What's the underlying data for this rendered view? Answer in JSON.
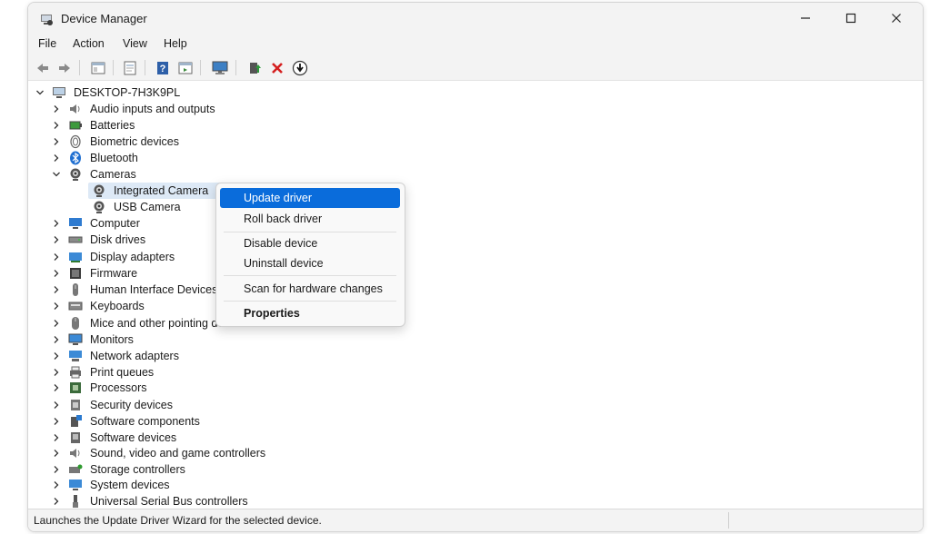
{
  "window": {
    "title": "Device Manager",
    "controls": [
      "—",
      "☐",
      "✕"
    ]
  },
  "menu": [
    "File",
    "Action",
    "View",
    "Help"
  ],
  "toolbar": [
    {
      "name": "back-arrow-icon"
    },
    {
      "name": "forward-arrow-icon"
    },
    {
      "name": "show-hide-tree-icon"
    },
    {
      "name": "properties-icon"
    },
    {
      "name": "help-icon"
    },
    {
      "name": "view-icon"
    },
    {
      "name": "monitor-icon"
    },
    {
      "name": "update-driver-icon"
    },
    {
      "name": "uninstall-x-icon"
    },
    {
      "name": "download-driver-icon"
    }
  ],
  "tree": {
    "root": "DESKTOP-7H3K9PL",
    "categories": [
      {
        "label": "Audio inputs and outputs",
        "icon": "speaker-icon",
        "expanded": false
      },
      {
        "label": "Batteries",
        "icon": "battery-icon",
        "expanded": false
      },
      {
        "label": "Biometric devices",
        "icon": "fingerprint-icon",
        "expanded": false
      },
      {
        "label": "Bluetooth",
        "icon": "bluetooth-icon",
        "expanded": false
      },
      {
        "label": "Cameras",
        "icon": "camera-icon",
        "expanded": true,
        "children": [
          {
            "label": "Integrated Camera",
            "icon": "camera-icon",
            "selected": true
          },
          {
            "label": "USB Camera",
            "icon": "camera-icon",
            "selected": false
          }
        ]
      },
      {
        "label": "Computer",
        "icon": "computer-icon",
        "expanded": false
      },
      {
        "label": "Disk drives",
        "icon": "disk-drive-icon",
        "expanded": false
      },
      {
        "label": "Display adapters",
        "icon": "display-adapter-icon",
        "expanded": false
      },
      {
        "label": "Firmware",
        "icon": "firmware-icon",
        "expanded": false
      },
      {
        "label": "Human Interface Devices",
        "icon": "hid-icon",
        "expanded": false
      },
      {
        "label": "Keyboards",
        "icon": "keyboard-icon",
        "expanded": false
      },
      {
        "label": "Mice and other pointing devices",
        "icon": "mouse-icon",
        "expanded": false
      },
      {
        "label": "Monitors",
        "icon": "monitor-icon",
        "expanded": false
      },
      {
        "label": "Network adapters",
        "icon": "network-adapter-icon",
        "expanded": false
      },
      {
        "label": "Print queues",
        "icon": "printer-icon",
        "expanded": false
      },
      {
        "label": "Processors",
        "icon": "processor-icon",
        "expanded": false
      },
      {
        "label": "Security devices",
        "icon": "security-device-icon",
        "expanded": false
      },
      {
        "label": "Software components",
        "icon": "software-component-icon",
        "expanded": false
      },
      {
        "label": "Software devices",
        "icon": "software-device-icon",
        "expanded": false
      },
      {
        "label": "Sound, video and game controllers",
        "icon": "sound-icon",
        "expanded": false
      },
      {
        "label": "Storage controllers",
        "icon": "storage-controller-icon",
        "expanded": false
      },
      {
        "label": "System devices",
        "icon": "system-device-icon",
        "expanded": false
      },
      {
        "label": "Universal Serial Bus controllers",
        "icon": "usb-icon",
        "expanded": false
      }
    ]
  },
  "context_menu": {
    "items": [
      {
        "label": "Update driver",
        "active": true,
        "bold": false
      },
      {
        "label": "Roll back driver",
        "active": false,
        "bold": false
      },
      {
        "label": "Disable device",
        "active": false,
        "bold": false
      },
      {
        "label": "Uninstall device",
        "active": false,
        "bold": false
      },
      {
        "label": "Scan for hardware changes",
        "active": false,
        "bold": false
      },
      {
        "label": "Properties",
        "active": false,
        "bold": true
      }
    ]
  },
  "status": {
    "text": "Launches the Update Driver Wizard for the selected device."
  },
  "colors": {
    "accent": "#0a6cdb",
    "selection": "#dde9f6",
    "chrome": "#f3f3f3"
  }
}
